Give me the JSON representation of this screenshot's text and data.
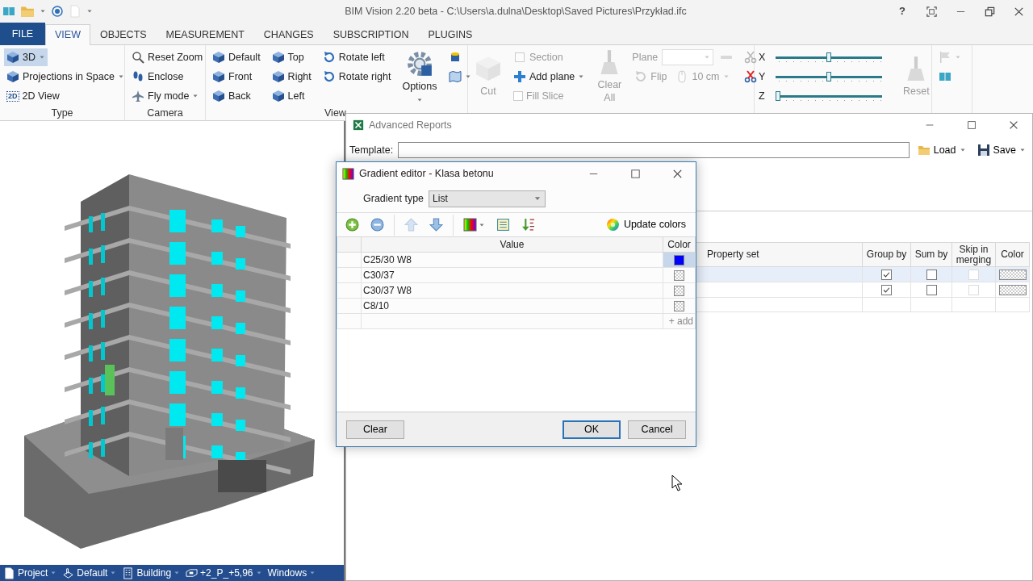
{
  "title_bar": {
    "title": "BIM Vision 2.20 beta - C:\\Users\\a.dulna\\Desktop\\Saved Pictures\\Przykład.ifc",
    "help": "?"
  },
  "ribbon_tabs": [
    {
      "label": "FILE",
      "kind": "file",
      "selected": false
    },
    {
      "label": "VIEW",
      "kind": "tab",
      "selected": true
    },
    {
      "label": "OBJECTS",
      "kind": "tab",
      "selected": false
    },
    {
      "label": "MEASUREMENT",
      "kind": "tab",
      "selected": false
    },
    {
      "label": "CHANGES",
      "kind": "tab",
      "selected": false
    },
    {
      "label": "SUBSCRIPTION",
      "kind": "tab",
      "selected": false
    },
    {
      "label": "PLUGINS",
      "kind": "tab",
      "selected": false
    }
  ],
  "ribbon_groups": [
    {
      "label": "Type",
      "columns": [
        [
          [
            {
              "kind": "small",
              "label": "3D",
              "dropdown": true,
              "selected": true
            }
          ],
          [
            {
              "kind": "small",
              "label": "Projections in Space",
              "dropdown": true,
              "selected": false
            }
          ],
          [
            {
              "kind": "small",
              "label": "2D View",
              "glyph": "2D",
              "selected": false
            }
          ]
        ]
      ]
    },
    {
      "label": "Camera",
      "columns": [
        [
          [
            {
              "kind": "small",
              "label": "Reset Zoom"
            }
          ],
          [
            {
              "kind": "small",
              "label": "Enclose"
            }
          ],
          [
            {
              "kind": "small",
              "label": "Fly mode",
              "dropdown": true
            }
          ]
        ]
      ]
    },
    {
      "label": "View",
      "columns": [
        [
          [
            {
              "kind": "small",
              "label": "Default"
            }
          ],
          [
            {
              "kind": "small",
              "label": "Front"
            }
          ],
          [
            {
              "kind": "small",
              "label": "Back"
            }
          ]
        ],
        [
          [
            {
              "kind": "small",
              "label": "Top"
            }
          ],
          [
            {
              "kind": "small",
              "label": "Right"
            }
          ],
          [
            {
              "kind": "small",
              "label": "Left"
            }
          ]
        ],
        [
          [
            {
              "kind": "small",
              "label": "Rotate left"
            }
          ],
          [
            {
              "kind": "small",
              "label": "Rotate right"
            }
          ]
        ],
        [
          [
            {
              "kind": "large",
              "label": "Options",
              "dropdown": true
            }
          ]
        ],
        [
          [
            {
              "kind": "icon"
            }
          ],
          [
            {
              "kind": "icon",
              "dropdown": true
            }
          ]
        ]
      ]
    },
    {
      "columns": [
        [
          [
            {
              "kind": "large",
              "label": "Cut",
              "disabled": true
            }
          ]
        ],
        [
          [
            {
              "kind": "small",
              "label": "Section",
              "disabled": true
            }
          ],
          [
            {
              "kind": "small",
              "label": "Add plane",
              "dropdown": true,
              "disabled": false
            }
          ],
          [
            {
              "kind": "check",
              "label": "Fill Slice",
              "checked": false,
              "disabled": true
            }
          ]
        ],
        [
          [
            {
              "kind": "large",
              "label": "Clear All",
              "disabled": true
            }
          ]
        ],
        [
          [
            {
              "kind": "label",
              "label": "Plane",
              "disabled": true
            },
            {
              "kind": "combo",
              "disabled": true
            },
            {
              "kind": "icon",
              "disabled": true
            }
          ],
          [
            {
              "kind": "small",
              "label": "Flip",
              "disabled": true
            },
            {
              "kind": "small",
              "label": "10 cm",
              "dropdown": true,
              "disabled": true
            }
          ]
        ],
        [
          [
            {
              "kind": "icon",
              "disabled": true
            }
          ],
          [
            {
              "kind": "icon",
              "disabled": false
            }
          ]
        ]
      ]
    },
    {
      "columns": [
        [
          [
            {
              "kind": "axis",
              "label": "X"
            },
            {
              "kind": "slider",
              "level": 0.5
            }
          ],
          [
            {
              "kind": "axis",
              "label": "Y"
            },
            {
              "kind": "slider",
              "level": 0.5
            }
          ],
          [
            {
              "kind": "axis",
              "label": "Z"
            },
            {
              "kind": "slider",
              "level": 0
            }
          ]
        ],
        [
          [
            {
              "kind": "large",
              "label": "Reset",
              "disabled": true
            }
          ]
        ]
      ]
    },
    {
      "columns": [
        [
          [
            {
              "kind": "icon",
              "dropdown": true,
              "disabled": true
            }
          ],
          [
            {
              "kind": "icon",
              "disabled": false
            }
          ]
        ]
      ]
    }
  ],
  "status_bar": [
    {
      "label": "Project"
    },
    {
      "label": "Default"
    },
    {
      "label": "Building"
    },
    {
      "label": "+2_P_+5,96"
    },
    {
      "label": "Windows"
    }
  ],
  "advanced_reports": {
    "title": "Advanced Reports",
    "template_label": "Template:",
    "actions": [
      "Load",
      "Save"
    ],
    "columns": [
      "Property set",
      "Group by",
      "Sum by",
      "Skip in merging",
      "Color"
    ],
    "rows": [
      {
        "selected": true,
        "group_by": true,
        "sum_by": false,
        "skip_in_merging": {
          "checked": false,
          "disabled": true
        }
      },
      {
        "selected": false,
        "group_by": true,
        "sum_by": false,
        "skip_in_merging": {
          "checked": false,
          "disabled": true
        }
      }
    ]
  },
  "gradient_editor": {
    "title": "Gradient editor - Klasa betonu",
    "type_label": "Gradient type",
    "type_value": "List",
    "toolbar": [
      {
        "kind": "add",
        "disabled": false
      },
      {
        "kind": "remove",
        "disabled": false
      },
      {
        "kind": "separator"
      },
      {
        "kind": "up",
        "disabled": true
      },
      {
        "kind": "down",
        "disabled": false
      },
      {
        "kind": "separator"
      },
      {
        "kind": "gradient",
        "disabled": false
      },
      {
        "kind": "list",
        "disabled": false
      },
      {
        "kind": "sort",
        "disabled": false
      }
    ],
    "update_colors": "Update colors",
    "columns": [
      "Value",
      "Color"
    ],
    "rows": [
      {
        "value": "C25/30 W8",
        "color": "#0000ff",
        "selected": true
      },
      {
        "value": "C30/37",
        "selected": false
      },
      {
        "value": "C30/37 W8",
        "selected": false
      },
      {
        "value": "C8/10",
        "selected": false
      }
    ],
    "add_label": "+ add",
    "left_buttons": [
      "Clear"
    ],
    "right_buttons": [
      {
        "label": "OK",
        "default": true
      },
      {
        "label": "Cancel",
        "default": false
      }
    ]
  }
}
